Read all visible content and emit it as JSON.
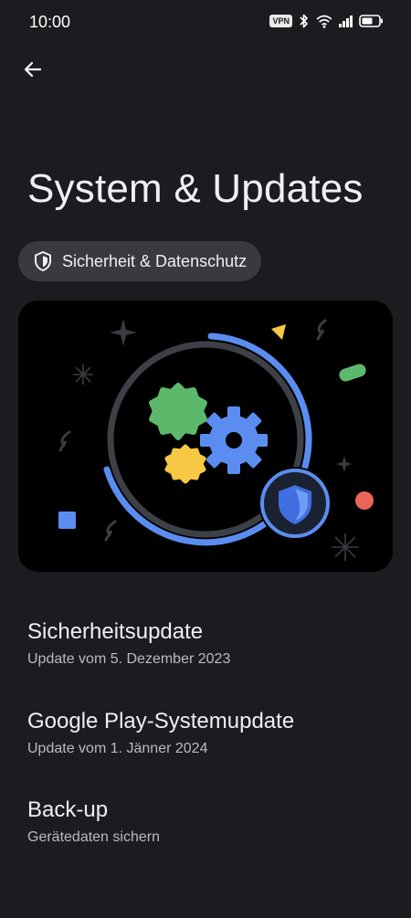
{
  "status_bar": {
    "time": "10:00",
    "vpn_label": "VPN",
    "icons": [
      "vpn-icon",
      "bluetooth-icon",
      "wifi-icon",
      "signal-icon",
      "battery-icon"
    ]
  },
  "header": {
    "back_icon": "arrow-left-icon",
    "title": "System & Updates"
  },
  "chip": {
    "icon": "shield-icon",
    "label": "Sicherheit & Datenschutz"
  },
  "hero": {
    "illustration": "gears-shield-illustration",
    "colors": {
      "blue": "#5b8df0",
      "green": "#5cb96b",
      "yellow": "#f7c843",
      "red": "#e8665a",
      "ring_gray": "#3d4046"
    }
  },
  "items": [
    {
      "title": "Sicherheitsupdate",
      "subtitle": "Update vom 5. Dezember 2023"
    },
    {
      "title": "Google Play-Systemupdate",
      "subtitle": "Update vom 1. Jänner 2024"
    },
    {
      "title": "Back-up",
      "subtitle": "Gerätedaten sichern"
    }
  ]
}
